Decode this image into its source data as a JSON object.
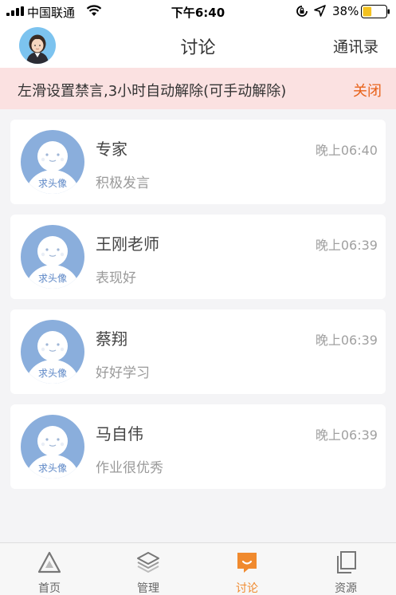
{
  "status_bar": {
    "carrier": "中国联通",
    "time": "下午6:40",
    "battery": "38%",
    "battery_level": 0.38
  },
  "nav": {
    "title": "讨论",
    "right_action": "通讯录"
  },
  "notice": {
    "text": "左滑设置禁言,3小时自动解除(可手动解除)",
    "close_label": "关闭"
  },
  "avatar_placeholder": "求头像",
  "conversations": [
    {
      "name": "专家",
      "time": "晚上06:40",
      "message": "积极发言"
    },
    {
      "name": "王刚老师",
      "time": "晚上06:39",
      "message": "表现好"
    },
    {
      "name": "蔡翔",
      "time": "晚上06:39",
      "message": "好好学习"
    },
    {
      "name": "马自伟",
      "time": "晚上06:39",
      "message": "作业很优秀"
    }
  ],
  "tabs": [
    {
      "label": "首页",
      "icon": "home-triangle-icon",
      "active": false
    },
    {
      "label": "管理",
      "icon": "layers-icon",
      "active": false
    },
    {
      "label": "讨论",
      "icon": "chat-bubble-icon",
      "active": true
    },
    {
      "label": "资源",
      "icon": "files-icon",
      "active": false
    }
  ],
  "colors": {
    "accent": "#f08a2e",
    "notice_bg": "#fbe1e1",
    "close_text": "#e8621a",
    "avatar_placeholder_bg": "#8aaedc"
  }
}
